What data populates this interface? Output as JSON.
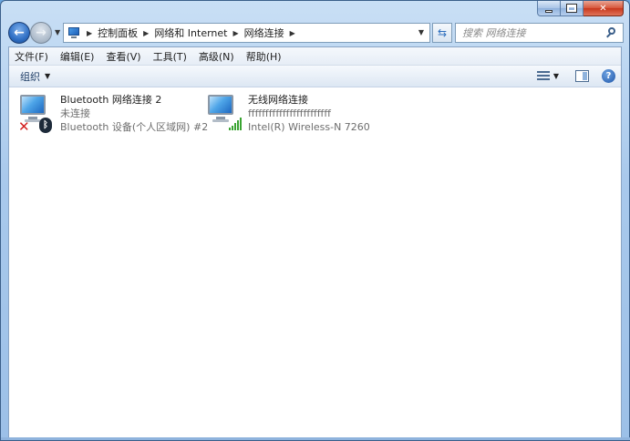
{
  "breadcrumb": [
    "控制面板",
    "网络和 Internet",
    "网络连接"
  ],
  "search": {
    "placeholder": "搜索 网络连接"
  },
  "menu": [
    "文件(F)",
    "编辑(E)",
    "查看(V)",
    "工具(T)",
    "高级(N)",
    "帮助(H)"
  ],
  "toolbar": {
    "organize_label": "组织"
  },
  "connections": [
    {
      "name": "Bluetooth 网络连接 2",
      "status": "未连接",
      "device": "Bluetooth 设备(个人区域网) #2",
      "icon": "network-disconnected-bluetooth-icon"
    },
    {
      "name": "无线网络连接",
      "status": "ffffffffffffffffffffffff",
      "device": "Intel(R) Wireless-N 7260",
      "icon": "wireless-signal-icon"
    }
  ],
  "colors": {
    "accent": "#2f6fc4",
    "error": "#d21f1f",
    "signal": "#3aa432"
  }
}
